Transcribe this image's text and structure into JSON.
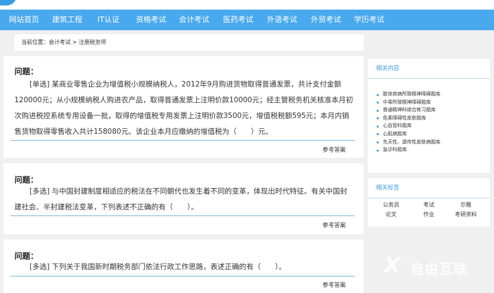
{
  "nav": {
    "items": [
      {
        "label": "网站首页"
      },
      {
        "label": "建筑工程"
      },
      {
        "label": "IT认证"
      },
      {
        "label": "资格考试"
      },
      {
        "label": "会计考试"
      },
      {
        "label": "医药考试"
      },
      {
        "label": "外语考试"
      },
      {
        "label": "外贸考试"
      },
      {
        "label": "学历考试"
      }
    ]
  },
  "breadcrumb": "当前位置：会计考试 > 注册税务师",
  "questions": [
    {
      "title": "问题：",
      "text": "[单选] 某商业零售企业为增值税小规模纳税人，2012年9月购进货物取得普通发票，共计支付金额120000元；从小规模纳税人购进农产品，取得普通发票上注明价款10000元；经主管税务机关核准本月初次购进税控系统专用设备一批，取得的增值税专用发票上注明价款3500元，增值税税额595元；本月内销售货物取得零售收入共计158080元。该企业本月应缴纳的增值税为（　　）元。",
      "answer": "参考答案"
    },
    {
      "title": "问题：",
      "text": "[多选] 与中国封建制度相适应的税法在不同朝代也发生着不同的变革，体现出时代特征。有关中国封建社会、半封建税法变革，下列表述不正确的有（　　）。",
      "answer": "参考答案"
    },
    {
      "title": "问题：",
      "text": "[多选] 下列关于我国新时期税务部门依法行政工作思路，表述正确的有（　　）。",
      "answer": "参考答案"
    }
  ],
  "related": {
    "title": "相关内容",
    "items": [
      {
        "label": "脏体疾病所致精神障碍题库"
      },
      {
        "label": "中毒所致精神障碍题库"
      },
      {
        "label": "普通精神科综合练习题库"
      },
      {
        "label": "色素障碍性皮肤题库"
      },
      {
        "label": "心血管科题库"
      },
      {
        "label": "心肌病题库"
      },
      {
        "label": "先天性、遗传性皮肤病题库"
      },
      {
        "label": "急诊科题库"
      }
    ]
  },
  "tags": {
    "title": "相关标签",
    "items": [
      {
        "label": "公务员"
      },
      {
        "label": "考试"
      },
      {
        "label": "尔雅"
      },
      {
        "label": "论文"
      },
      {
        "label": "作业"
      },
      {
        "label": "考研资料"
      }
    ]
  },
  "watermark": {
    "mark": "X",
    "text": "自由互联"
  }
}
